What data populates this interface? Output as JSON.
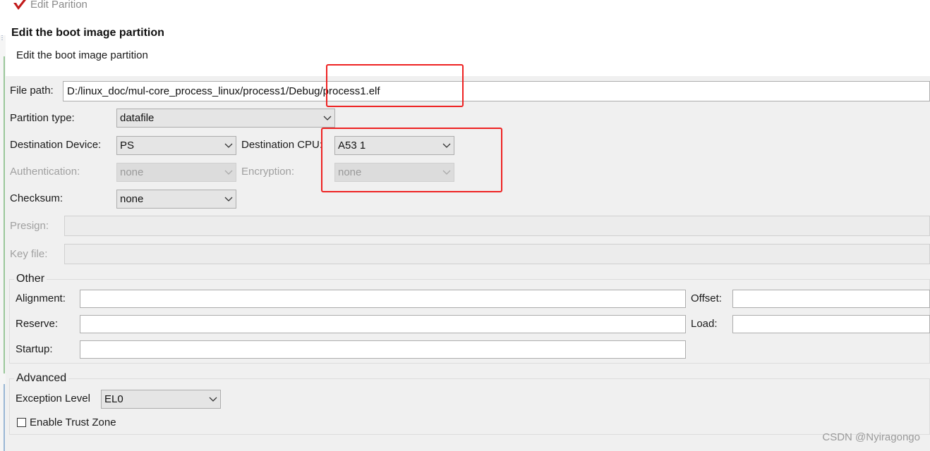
{
  "window": {
    "title": "Edit Parition"
  },
  "header": {
    "title": "Edit the boot image partition",
    "description": "Edit the boot image partition"
  },
  "form": {
    "file_path": {
      "label": "File path:",
      "value": "D:/linux_doc/mul-core_process_linux/process1/Debug/process1.elf"
    },
    "partition_type": {
      "label": "Partition type:",
      "value": "datafile"
    },
    "destination_device": {
      "label": "Destination Device:",
      "value": "PS"
    },
    "destination_cpu": {
      "label": "Destination CPU:",
      "value": "A53 1"
    },
    "authentication": {
      "label": "Authentication:",
      "value": "none",
      "enabled": false
    },
    "encryption": {
      "label": "Encryption:",
      "value": "none",
      "enabled": false
    },
    "checksum": {
      "label": "Checksum:",
      "value": "none"
    },
    "presign": {
      "label": "Presign:",
      "value": "",
      "enabled": false
    },
    "key_file": {
      "label": "Key file:",
      "value": "",
      "enabled": false
    }
  },
  "other": {
    "title": "Other",
    "alignment": {
      "label": "Alignment:",
      "value": ""
    },
    "offset": {
      "label": "Offset:",
      "value": ""
    },
    "reserve": {
      "label": "Reserve:",
      "value": ""
    },
    "load": {
      "label": "Load:",
      "value": ""
    },
    "startup": {
      "label": "Startup:",
      "value": ""
    }
  },
  "advanced": {
    "title": "Advanced",
    "exception_level": {
      "label": "Exception Level",
      "value": "EL0"
    },
    "trust_zone": {
      "label": "Enable Trust Zone",
      "checked": false
    }
  },
  "watermark": "CSDN @Nyiragongo",
  "colors": {
    "highlight_box": "#ee2222",
    "window_bg": "#f0f0f0",
    "field_border": "#adadad"
  },
  "icons": {
    "app": "xilinx-logo-icon",
    "dropdown": "chevron-down-icon"
  }
}
